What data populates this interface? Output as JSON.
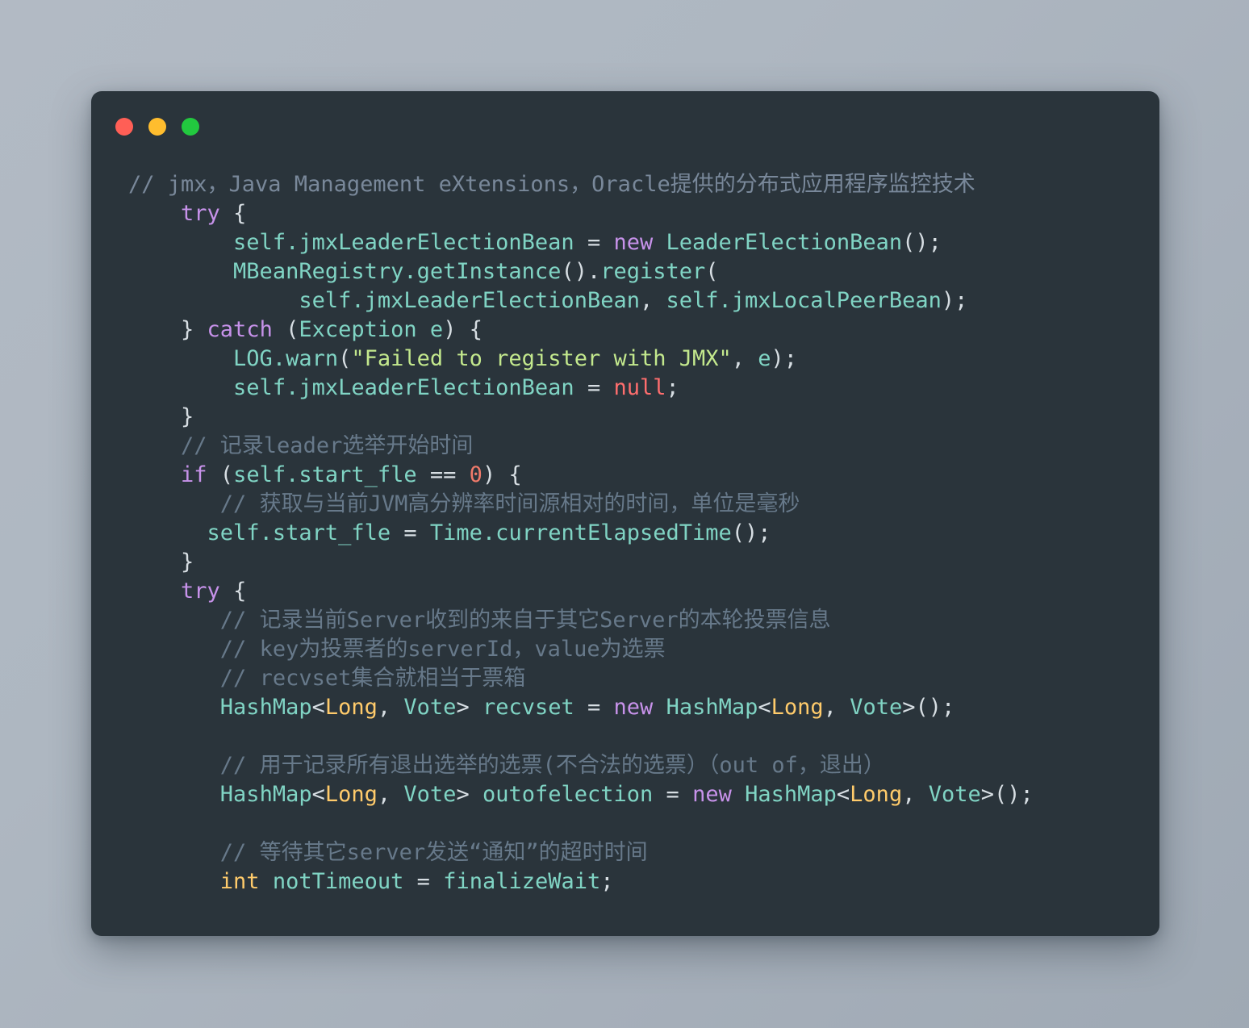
{
  "window": {
    "title": "",
    "traffic_lights": [
      {
        "name": "close-button",
        "color": "#ff5f56"
      },
      {
        "name": "minimize-button",
        "color": "#ffbd2e"
      },
      {
        "name": "maximize-button",
        "color": "#22c93f"
      }
    ],
    "background_color": "#2a343b",
    "page_background": "#aeb7c1"
  },
  "theme": {
    "comment": "#67798a",
    "comment_light": "#79889a",
    "keyword": "#c792ea",
    "identifier": "#80d4c4",
    "string": "#c3e88d",
    "number": "#f07a6a",
    "null_literal": "#ff6e6e",
    "type": "#ffcb6b",
    "punctuation": "#d7dee3"
  },
  "code": {
    "language": "java",
    "lines": [
      {
        "indent": 0,
        "tokens": [
          {
            "t": "comment-l",
            "s": "// jmx，Java Management eXtensions，Oracle提供的分布式应用程序监控技术"
          }
        ]
      },
      {
        "indent": 4,
        "tokens": [
          {
            "t": "kw",
            "s": "try"
          },
          {
            "t": "punc",
            "s": " {"
          }
        ]
      },
      {
        "indent": 8,
        "tokens": [
          {
            "t": "id",
            "s": "self.jmxLeaderElectionBean"
          },
          {
            "t": "punc",
            "s": " = "
          },
          {
            "t": "kw",
            "s": "new"
          },
          {
            "t": "punc",
            "s": " "
          },
          {
            "t": "id",
            "s": "LeaderElectionBean"
          },
          {
            "t": "punc",
            "s": "();"
          }
        ]
      },
      {
        "indent": 8,
        "tokens": [
          {
            "t": "id",
            "s": "MBeanRegistry.getInstance"
          },
          {
            "t": "punc",
            "s": "()."
          },
          {
            "t": "id",
            "s": "register"
          },
          {
            "t": "punc",
            "s": "("
          }
        ]
      },
      {
        "indent": 13,
        "tokens": [
          {
            "t": "id",
            "s": "self.jmxLeaderElectionBean"
          },
          {
            "t": "punc",
            "s": ", "
          },
          {
            "t": "id",
            "s": "self.jmxLocalPeerBean"
          },
          {
            "t": "punc",
            "s": ");"
          }
        ]
      },
      {
        "indent": 4,
        "tokens": [
          {
            "t": "punc",
            "s": "} "
          },
          {
            "t": "kw",
            "s": "catch"
          },
          {
            "t": "punc",
            "s": " ("
          },
          {
            "t": "id",
            "s": "Exception"
          },
          {
            "t": "punc",
            "s": " "
          },
          {
            "t": "id",
            "s": "e"
          },
          {
            "t": "punc",
            "s": ") {"
          }
        ]
      },
      {
        "indent": 8,
        "tokens": [
          {
            "t": "id",
            "s": "LOG.warn"
          },
          {
            "t": "punc",
            "s": "("
          },
          {
            "t": "str",
            "s": "\"Failed to register with JMX\""
          },
          {
            "t": "punc",
            "s": ", "
          },
          {
            "t": "id",
            "s": "e"
          },
          {
            "t": "punc",
            "s": ");"
          }
        ]
      },
      {
        "indent": 8,
        "tokens": [
          {
            "t": "id",
            "s": "self.jmxLeaderElectionBean"
          },
          {
            "t": "punc",
            "s": " = "
          },
          {
            "t": "null",
            "s": "null"
          },
          {
            "t": "punc",
            "s": ";"
          }
        ]
      },
      {
        "indent": 4,
        "tokens": [
          {
            "t": "punc",
            "s": "}"
          }
        ]
      },
      {
        "indent": 4,
        "tokens": [
          {
            "t": "comment",
            "s": "// 记录leader选举开始时间"
          }
        ]
      },
      {
        "indent": 4,
        "tokens": [
          {
            "t": "kw",
            "s": "if"
          },
          {
            "t": "punc",
            "s": " ("
          },
          {
            "t": "id",
            "s": "self.start_fle"
          },
          {
            "t": "punc",
            "s": " == "
          },
          {
            "t": "num",
            "s": "0"
          },
          {
            "t": "punc",
            "s": ") {"
          }
        ]
      },
      {
        "indent": 7,
        "tokens": [
          {
            "t": "comment",
            "s": "// 获取与当前JVM高分辨率时间源相对的时间，单位是毫秒"
          }
        ]
      },
      {
        "indent": 6,
        "tokens": [
          {
            "t": "id",
            "s": "self.start_fle"
          },
          {
            "t": "punc",
            "s": " = "
          },
          {
            "t": "id",
            "s": "Time.currentElapsedTime"
          },
          {
            "t": "punc",
            "s": "();"
          }
        ]
      },
      {
        "indent": 4,
        "tokens": [
          {
            "t": "punc",
            "s": "}"
          }
        ]
      },
      {
        "indent": 4,
        "tokens": [
          {
            "t": "kw",
            "s": "try"
          },
          {
            "t": "punc",
            "s": " {"
          }
        ]
      },
      {
        "indent": 7,
        "tokens": [
          {
            "t": "comment",
            "s": "// 记录当前Server收到的来自于其它Server的本轮投票信息"
          }
        ]
      },
      {
        "indent": 7,
        "tokens": [
          {
            "t": "comment",
            "s": "// key为投票者的serverId，value为选票"
          }
        ]
      },
      {
        "indent": 7,
        "tokens": [
          {
            "t": "comment",
            "s": "// recvset集合就相当于票箱"
          }
        ]
      },
      {
        "indent": 7,
        "tokens": [
          {
            "t": "id",
            "s": "HashMap"
          },
          {
            "t": "punc",
            "s": "<"
          },
          {
            "t": "type",
            "s": "Long"
          },
          {
            "t": "punc",
            "s": ", "
          },
          {
            "t": "id",
            "s": "Vote"
          },
          {
            "t": "punc",
            "s": "> "
          },
          {
            "t": "id",
            "s": "recvset"
          },
          {
            "t": "punc",
            "s": " = "
          },
          {
            "t": "kw",
            "s": "new"
          },
          {
            "t": "punc",
            "s": " "
          },
          {
            "t": "id",
            "s": "HashMap"
          },
          {
            "t": "punc",
            "s": "<"
          },
          {
            "t": "type",
            "s": "Long"
          },
          {
            "t": "punc",
            "s": ", "
          },
          {
            "t": "id",
            "s": "Vote"
          },
          {
            "t": "punc",
            "s": ">();"
          }
        ]
      },
      {
        "indent": 0,
        "blank": true,
        "tokens": []
      },
      {
        "indent": 7,
        "tokens": [
          {
            "t": "comment",
            "s": "// 用于记录所有退出选举的选票(不合法的选票）（out of，退出）"
          }
        ]
      },
      {
        "indent": 7,
        "tokens": [
          {
            "t": "id",
            "s": "HashMap"
          },
          {
            "t": "punc",
            "s": "<"
          },
          {
            "t": "type",
            "s": "Long"
          },
          {
            "t": "punc",
            "s": ", "
          },
          {
            "t": "id",
            "s": "Vote"
          },
          {
            "t": "punc",
            "s": "> "
          },
          {
            "t": "id",
            "s": "outofelection"
          },
          {
            "t": "punc",
            "s": " = "
          },
          {
            "t": "kw",
            "s": "new"
          },
          {
            "t": "punc",
            "s": " "
          },
          {
            "t": "id",
            "s": "HashMap"
          },
          {
            "t": "punc",
            "s": "<"
          },
          {
            "t": "type",
            "s": "Long"
          },
          {
            "t": "punc",
            "s": ", "
          },
          {
            "t": "id",
            "s": "Vote"
          },
          {
            "t": "punc",
            "s": ">();"
          }
        ]
      },
      {
        "indent": 0,
        "blank": true,
        "tokens": []
      },
      {
        "indent": 7,
        "tokens": [
          {
            "t": "comment",
            "s": "// 等待其它server发送“通知”的超时时间"
          }
        ]
      },
      {
        "indent": 7,
        "tokens": [
          {
            "t": "type",
            "s": "int"
          },
          {
            "t": "punc",
            "s": " "
          },
          {
            "t": "id",
            "s": "notTimeout"
          },
          {
            "t": "punc",
            "s": " = "
          },
          {
            "t": "id",
            "s": "finalizeWait"
          },
          {
            "t": "punc",
            "s": ";"
          }
        ]
      }
    ]
  }
}
